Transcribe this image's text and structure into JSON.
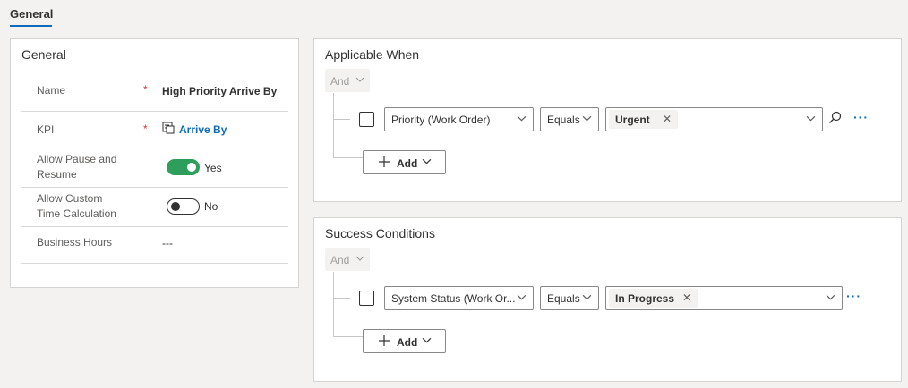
{
  "tabs": [
    {
      "label": "General"
    }
  ],
  "general": {
    "title": "General",
    "fields": [
      {
        "label": "Name",
        "required": "*",
        "value": "High Priority Arrive By"
      },
      {
        "label": "KPI",
        "required": "*",
        "value": "Arrive By",
        "icon": "kpi-icon"
      },
      {
        "label": "Allow Pause and Resume",
        "value": "Yes",
        "toggle": true
      },
      {
        "label": "Allow Custom Time Calculation",
        "value": "No",
        "toggle": false
      },
      {
        "label": "Business Hours",
        "value": "---"
      }
    ]
  },
  "applicable": {
    "title": "Applicable When",
    "operator": "And",
    "condition": {
      "field": "Priority (Work Order)",
      "op": "Equals",
      "value": "Urgent"
    },
    "add_label": "Add"
  },
  "success": {
    "title": "Success Conditions",
    "operator": "And",
    "condition": {
      "field": "System Status (Work Or...",
      "op": "Equals",
      "value": "In Progress"
    },
    "add_label": "Add"
  },
  "colors": {
    "accent": "#0f6cbd",
    "toggle_on": "#2e9e5b",
    "required": "#d13438"
  }
}
